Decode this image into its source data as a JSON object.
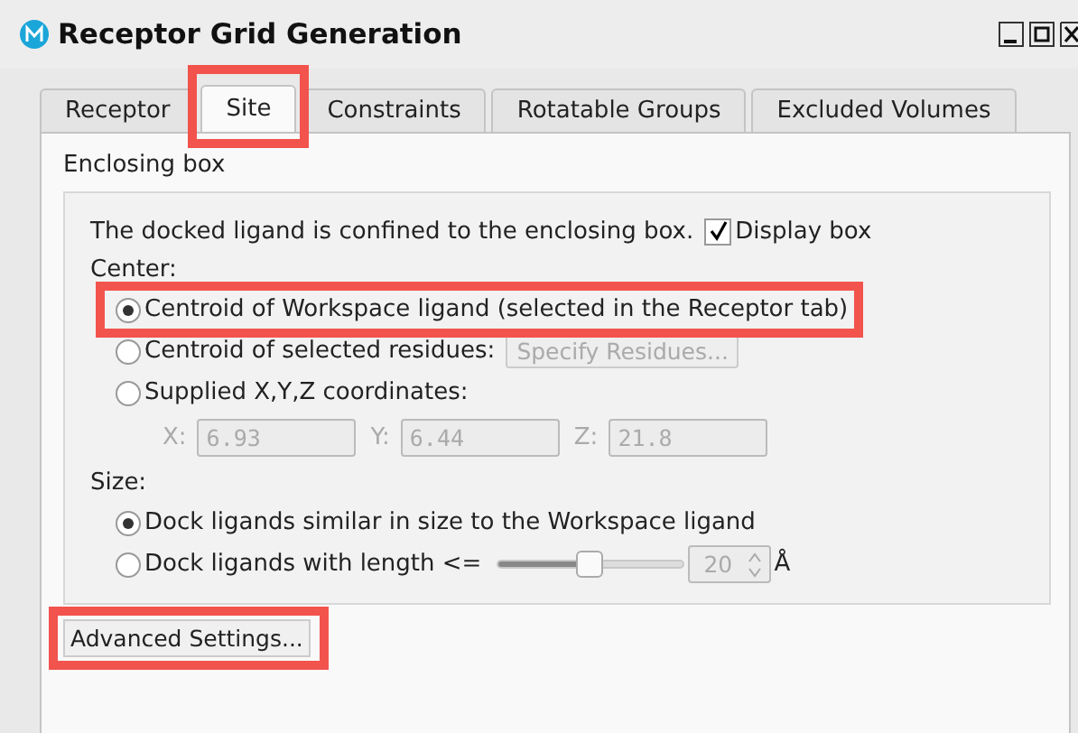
{
  "window": {
    "title": "Receptor Grid Generation"
  },
  "tabs": [
    {
      "label": "Receptor",
      "selected": false,
      "highlighted": false
    },
    {
      "label": "Site",
      "selected": true,
      "highlighted": true
    },
    {
      "label": "Constraints",
      "selected": false,
      "highlighted": false
    },
    {
      "label": "Rotatable Groups",
      "selected": false,
      "highlighted": false
    },
    {
      "label": "Excluded Volumes",
      "selected": false,
      "highlighted": false
    }
  ],
  "group": {
    "title": "Enclosing box",
    "description": "The docked ligand is confined to the enclosing box.",
    "display_box": {
      "label": "Display box",
      "checked": true
    }
  },
  "center": {
    "label": "Center:",
    "options": [
      {
        "kind": "plain",
        "label": "Centroid of Workspace ligand (selected in the Receptor tab)",
        "selected": true,
        "highlighted": true
      },
      {
        "kind": "button",
        "label": "Centroid of selected residues:",
        "selected": false,
        "highlighted": false,
        "button": "Specify Residues...",
        "button_disabled": true
      },
      {
        "kind": "plain",
        "label": "Supplied X,Y,Z coordinates:",
        "selected": false,
        "highlighted": false
      }
    ],
    "coordinates_disabled": true,
    "coordinates": [
      {
        "label": "X:",
        "value": "6.93"
      },
      {
        "label": "Y:",
        "value": "6.44"
      },
      {
        "label": "Z:",
        "value": "21.8"
      }
    ]
  },
  "size": {
    "label": "Size:",
    "options": [
      {
        "kind": "plain",
        "label": "Dock ligands similar in size to the Workspace ligand",
        "selected": true
      },
      {
        "kind": "slider",
        "label": "Dock ligands with length <=",
        "selected": false,
        "level": 0.5,
        "value": "20",
        "value_disabled": true,
        "unit": "Å"
      }
    ]
  },
  "advanced_button": {
    "label": "Advanced Settings...",
    "highlighted": true
  }
}
